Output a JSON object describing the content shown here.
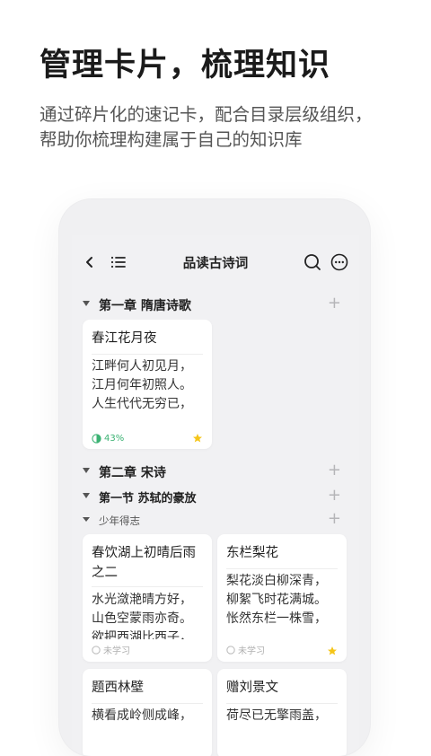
{
  "promo": {
    "title": "管理卡片，梳理知识",
    "subtitle_line1": "通过碎片化的速记卡，配合目录层级组织，",
    "subtitle_line2": "帮助你梳理构建属于自己的知识库"
  },
  "nav": {
    "title": "品读古诗词",
    "icons": [
      "back-icon",
      "catalog-list-icon",
      "search-icon",
      "more-icon"
    ]
  },
  "sections": {
    "ch1": {
      "label": "第一章  隋唐诗歌",
      "add": "+"
    },
    "ch2": {
      "label": "第二章  宋诗",
      "add": "+"
    },
    "sec1": {
      "label": "第一节  苏轼的豪放",
      "add": "+"
    },
    "sub1": {
      "label": "少年得志",
      "add": "+"
    }
  },
  "cards": {
    "c1": {
      "title": "春江花月夜",
      "body": "江畔何人初见月，\n江月何年初照人。\n人生代代无穷已，",
      "status": "43%",
      "progress": 0.43,
      "starred": true
    },
    "c2": {
      "title": "春饮湖上初晴后雨之二",
      "body": "水光潋滟晴方好，\n山色空蒙雨亦奇。\n欲把西湖比西子，",
      "status": "未学习",
      "starred": false
    },
    "c3": {
      "title": "东栏梨花",
      "body": "梨花淡白柳深青，\n柳絮飞时花满城。\n怅然东栏一株雪，",
      "status": "未学习",
      "starred": true
    },
    "c4": {
      "title": "题西林壁",
      "body": "横看成岭侧成峰，"
    },
    "c5": {
      "title": "赠刘景文",
      "body": "荷尽已无擎雨盖，"
    }
  },
  "colors": {
    "accent_green": "#3bb273",
    "star": "#f5c518",
    "background": "#f1f1f3"
  }
}
